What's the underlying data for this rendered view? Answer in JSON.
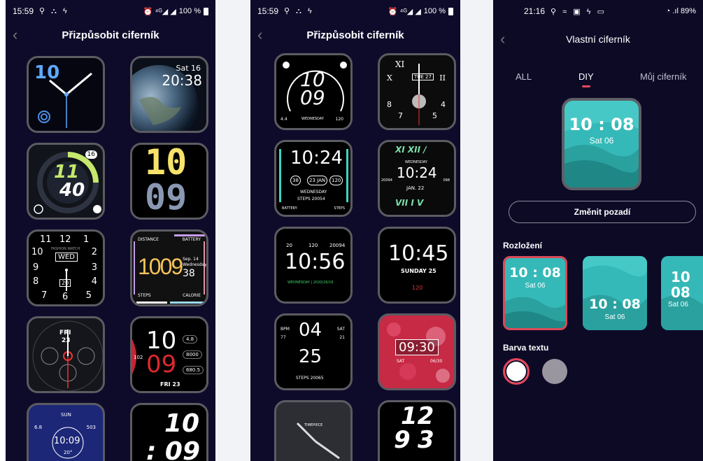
{
  "phone1": {
    "status": {
      "time": "15:59",
      "icons": "⚲ ⛬ ϟ",
      "alarm_signal": "⏰ ⁴ᴳ◢ ◢",
      "battery": "100 %"
    },
    "header": {
      "title": "Přizpůsobit ciferník",
      "back": "‹"
    },
    "faces": {
      "f1": {
        "hour": "10"
      },
      "f2": {
        "date": "Sat 16",
        "time": "20:38"
      },
      "f3": {
        "hour": "11",
        "minute": "40",
        "badge": "16"
      },
      "f4": {
        "hour": "10",
        "minute": "09"
      },
      "f5": {
        "n11": "11",
        "n12": "12",
        "n1": "1",
        "n10": "10",
        "n2": "2",
        "n9": "9",
        "n3": "3",
        "n8": "8",
        "n4": "4",
        "n7": "7",
        "n6": "6",
        "n5": "5",
        "day": "WED",
        "date": "20",
        "brand": "FASHION WATCH"
      },
      "f6": {
        "distance": "DISTANCE",
        "battery": "BATTERY",
        "time": "1009",
        "date": "Sep. 14",
        "weekday": "Wednesday",
        "sec": "38",
        "steps": "STEPS",
        "calorie": "CALORIE"
      },
      "f7": {
        "day": "FRI",
        "date": "23"
      },
      "f8": {
        "hour": "10",
        "minute": "09",
        "hr": "102",
        "v1": "4.8",
        "v2": "8000",
        "v3": "680.5",
        "date": "FRI 23"
      },
      "f9": {
        "sun": "SUN",
        "time": "10:09",
        "temp": "20°",
        "v1": "6.8",
        "v2": "503"
      },
      "f10": {
        "hour": "10",
        "minute": ": 09"
      }
    }
  },
  "phone2": {
    "status": {
      "time": "15:59",
      "icons": "⚲ ⛬ ϟ",
      "alarm_signal": "⏰ ⁴ᴳ◢ ◢",
      "battery": "100 %"
    },
    "header": {
      "title": "Přizpůsobit ciferník",
      "back": "‹"
    },
    "faces": {
      "f1": {
        "hour": "10",
        "minute": "09",
        "weekday": "WEDNESDAY",
        "v1": "4.4",
        "v2": "120"
      },
      "f2": {
        "date": "TUE 27",
        "n12": "XI",
        "n2": "II",
        "n9": "X",
        "n8": "8",
        "n7": "7",
        "n5": "5",
        "n4": "4"
      },
      "f3": {
        "time": "10:24",
        "c1": "38",
        "c2": "23 JAN",
        "c3": "120",
        "weekday": "WEDNESDAY",
        "steps": "STEPS 20054",
        "battery": "BATTERY",
        "steps_label": "STEPS"
      },
      "f4": {
        "top": "XI XII /",
        "weekday": "WEDNESDAY",
        "time": "10:24",
        "date": "JAN. 22",
        "bottom": "VII I V",
        "side1": "20094",
        "side2": "098"
      },
      "f5": {
        "v1": "20",
        "v2": "120",
        "v3": "20094",
        "time": "10:56",
        "date": "WEDNESDAY | 2020/26/16"
      },
      "f6": {
        "time": "10:45",
        "day": "SUNDAY 25",
        "hr": "120"
      },
      "f7": {
        "bpm": "BPM",
        "sat": "SAT",
        "v1": "77",
        "v2": "21",
        "hour": "04",
        "minute": "25",
        "steps": "STEPS 20065"
      },
      "f8": {
        "time": "09:30",
        "day": "SAT",
        "date": "06/30"
      },
      "f9": {
        "brand": "TIMEPIECE"
      },
      "f10": {
        "hour": "12",
        "minute": "9",
        "sec": "3"
      }
    }
  },
  "phone3": {
    "status": {
      "time": "21:16",
      "icons": "⚲ ≈ ▣ ϟ ▭",
      "right": "◔ .ıl 89%"
    },
    "header": {
      "title": "Vlastní ciferník",
      "back": "‹"
    },
    "tabs": [
      {
        "label": "ALL"
      },
      {
        "label": "DIY"
      },
      {
        "label": "Můj ciferník"
      }
    ],
    "preview": {
      "time": "10 : 08",
      "date": "Sat 06"
    },
    "change_bg": "Změnit pozadí",
    "layout_label": "Rozložení",
    "layouts": [
      {
        "time": "10 : 08",
        "date": "Sat 06"
      },
      {
        "time": "10 : 08",
        "date": "Sat 06"
      },
      {
        "hour": "10",
        "minute": "08",
        "date": "Sat 06"
      }
    ],
    "text_color_label": "Barva textu",
    "colors": {
      "white": "#ffffff",
      "gray": "#9a96a0",
      "accent": "#e8455a",
      "teal": "#3dc4c4"
    }
  }
}
